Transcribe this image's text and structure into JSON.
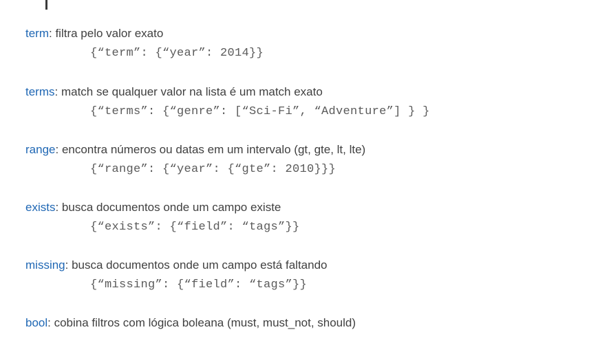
{
  "filters": [
    {
      "keyword": "term",
      "description": "filtra pelo valor exato",
      "example": "{“term”: {“year”: 2014}}"
    },
    {
      "keyword": "terms",
      "description": "match se qualquer valor na lista é um match exato",
      "example": "{“terms”: {“genre”: [“Sci-Fi”, “Adventure”] } }"
    },
    {
      "keyword": "range",
      "description": "encontra números ou datas em um intervalo (gt, gte, lt, lte)",
      "example": "{“range”: {“year”: {“gte”: 2010}}}"
    },
    {
      "keyword": "exists",
      "description": "busca documentos onde um campo existe",
      "example": "{“exists”: {“field”: “tags”}}"
    },
    {
      "keyword": "missing",
      "description": "busca documentos onde um campo está faltando",
      "example": "{“missing”: {“field”: “tags”}}"
    },
    {
      "keyword": "bool",
      "description": "cobina filtros com lógica boleana (must, must_not, should)",
      "example": ""
    }
  ],
  "separator": ": ",
  "colors": {
    "keyword": "#1f67b4",
    "text": "#404040",
    "code": "#5a5a5a"
  }
}
